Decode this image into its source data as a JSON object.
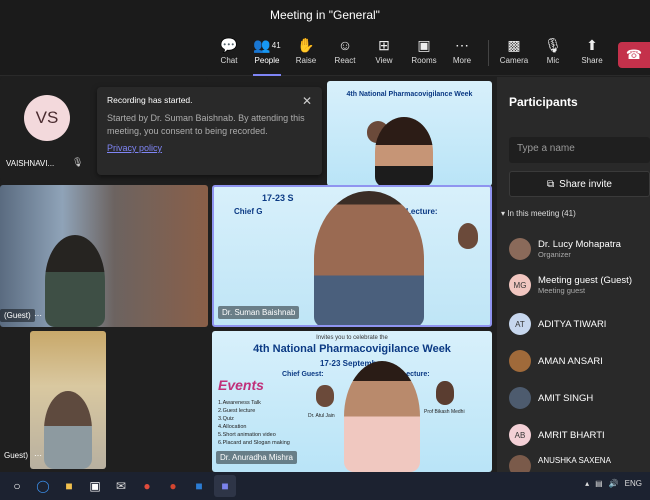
{
  "window": {
    "title": "Meeting in \"General\""
  },
  "toolbar": {
    "chat": "Chat",
    "people": "People",
    "people_count": "41",
    "raise": "Raise",
    "react": "React",
    "view": "View",
    "rooms": "Rooms",
    "more": "More",
    "camera": "Camera",
    "mic": "Mic",
    "share": "Share"
  },
  "toast": {
    "title": "Recording has started.",
    "body": "Started by Dr. Suman Baishnab. By attending this meeting, you consent to being recorded.",
    "link": "Privacy policy"
  },
  "tiles": {
    "vs_initials": "VS",
    "vaishnavi_label": "VAISHNAVI...",
    "guest_label_1": "(Guest)",
    "guest_label_2": "Guest)",
    "suman_label": "Dr. Suman Baishnab",
    "anuradha_label": "Dr. Anuradha Mishra",
    "poster_invite": "Invites you to celebrate the",
    "poster_title": "4th National Pharmacovigilance Week",
    "poster_dates": "17-23 September",
    "poster_chief": "Chief Guest:",
    "poster_lecture": "Lecture:",
    "poster_events": "Events",
    "poster_list": [
      "1.Awareness Talk",
      "2.Guest lecture",
      "3.Quiz",
      "4.Allocation",
      "5.Short animation video",
      "6.Placard and Slogan making"
    ],
    "poster_speaker1": "Dr. Atul Jain",
    "poster_speaker2": "Prof Bikash Medhi",
    "top_poster_title": "4th National Pharmacovigilance Week",
    "mid_poster_dates": "17-23 S",
    "mid_poster_chief": "Chief G",
    "mid_poster_lecture": "Lecture:"
  },
  "panel": {
    "title": "Participants",
    "search_placeholder": "Type a name",
    "invite": "Share invite",
    "section": "In this meeting (41)",
    "participants": [
      {
        "initials": "",
        "name": "Dr. Lucy Mohapatra",
        "sub": "Organizer",
        "color": "#8a6a5a"
      },
      {
        "initials": "MG",
        "name": "Meeting guest (Guest)",
        "sub": "Meeting guest",
        "color": "#f1c6c0"
      },
      {
        "initials": "AT",
        "name": "ADITYA TIWARI",
        "sub": "",
        "color": "#c7d7ee"
      },
      {
        "initials": "",
        "name": "AMAN ANSARI",
        "sub": "",
        "color": "#a06a3a"
      },
      {
        "initials": "",
        "name": "AMIT SINGH",
        "sub": "",
        "color": "#4d5b6e"
      },
      {
        "initials": "AB",
        "name": "AMRIT BHARTI",
        "sub": "",
        "color": "#f3d0d6"
      },
      {
        "initials": "",
        "name": "ANUSHKA SAXENA",
        "sub": "",
        "color": "#7a5a4a"
      }
    ]
  },
  "taskbar": {
    "lang": "ENG"
  }
}
